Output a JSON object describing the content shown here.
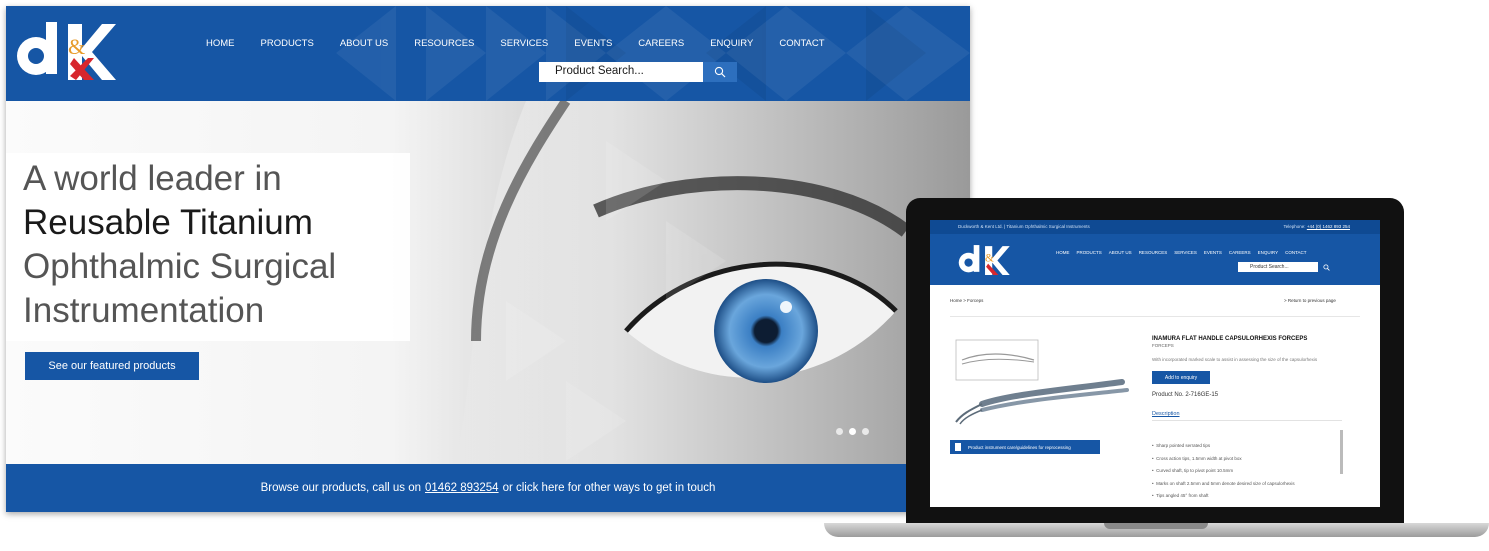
{
  "colors": {
    "brand_blue": "#1656a5",
    "white": "#ffffff"
  },
  "desktop": {
    "nav": [
      "HOME",
      "PRODUCTS",
      "ABOUT US",
      "RESOURCES",
      "SERVICES",
      "EVENTS",
      "CAREERS",
      "ENQUIRY",
      "CONTACT"
    ],
    "search": {
      "placeholder": "Product Search...",
      "icon": "search-icon"
    },
    "hero": {
      "line1": "A world leader in",
      "line2": "Reusable Titanium",
      "line3": "Ophthalmic Surgical",
      "line4": "Instrumentation",
      "cta": "See our featured products"
    },
    "footer": {
      "before": "Browse our products, call us on",
      "phone": "01462 893254",
      "after": "or click here for other ways to get in touch"
    }
  },
  "laptop": {
    "topbar": {
      "company": "Duckworth & Kent Ltd. | Titanium Ophthalmic Surgical Instruments",
      "tel_label": "Telephone:",
      "tel": "+44 (0) 1462 893 254"
    },
    "nav": [
      "HOME",
      "PRODUCTS",
      "ABOUT US",
      "RESOURCES",
      "SERVICES",
      "EVENTS",
      "CAREERS",
      "ENQUIRY",
      "CONTACT"
    ],
    "search_placeholder": "Product Search...",
    "breadcrumb": "Home  >  Forceps",
    "return_link": ">  Return to previous page",
    "product": {
      "title": "INAMURA FLAT HANDLE CAPSULORHEXIS FORCEPS",
      "category": "FORCEPS",
      "description": "With incorporated marked scale to assist in assessing the size of the capsulorhexis",
      "add_button": "Add to enquiry",
      "product_no": "Product No. 2-716GE-15",
      "tab": "Description",
      "care_link": "Product instrument care/guidelines for reprocessing",
      "bullets": [
        "Sharp pointed serrated tips",
        "Cross action tips, 1.5mm width at pivot box",
        "Curved shaft, tip to pivot point 10.5mm",
        "Marks on shaft 2.5mm and 5mm denote desired size of capsulorhexis",
        "Tips angled 45° from shaft"
      ]
    }
  }
}
